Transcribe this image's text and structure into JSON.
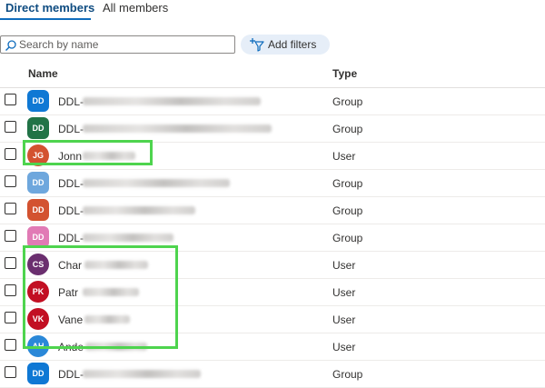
{
  "tabs": {
    "direct_members": "Direct members",
    "all_members": "All members"
  },
  "search": {
    "placeholder": "Search by name",
    "value": ""
  },
  "filters": {
    "add_label": "Add filters"
  },
  "columns": {
    "name": "Name",
    "type": "Type"
  },
  "colors": {
    "accent": "#0f6cbd",
    "highlight": "#4ed44e",
    "avatar_blue": "#0f78d4",
    "avatar_green": "#217346",
    "avatar_orange": "#d35230",
    "avatar_light_blue": "#6ea7dd",
    "avatar_pink": "#e17ab5",
    "avatar_purple": "#6b2f6f",
    "avatar_red": "#c20f23",
    "avatar_sky": "#2a88d8"
  },
  "members": [
    {
      "initials": "DD",
      "name": "DDL-",
      "type": "Group"
    },
    {
      "initials": "DD",
      "name": "DDL-",
      "type": "Group"
    },
    {
      "initials": "JG",
      "name": "Jonn",
      "type": "User"
    },
    {
      "initials": "DD",
      "name": "DDL-",
      "type": "Group"
    },
    {
      "initials": "DD",
      "name": "DDL-",
      "type": "Group"
    },
    {
      "initials": "DD",
      "name": "DDL-",
      "type": "Group"
    },
    {
      "initials": "CS",
      "name": "Char",
      "type": "User"
    },
    {
      "initials": "PK",
      "name": "Patr",
      "type": "User"
    },
    {
      "initials": "VK",
      "name": "Vane",
      "type": "User"
    },
    {
      "initials": "AH",
      "name": "Ande",
      "type": "User"
    },
    {
      "initials": "DD",
      "name": "DDL-",
      "type": "Group"
    }
  ]
}
